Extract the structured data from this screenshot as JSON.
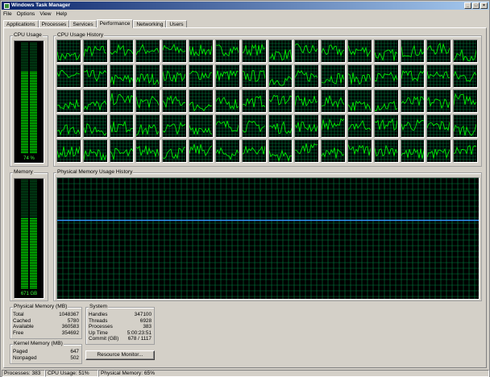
{
  "window": {
    "title": "Windows Task Manager"
  },
  "menu": [
    "File",
    "Options",
    "View",
    "Help"
  ],
  "tabs": [
    "Applications",
    "Processes",
    "Services",
    "Performance",
    "Networking",
    "Users"
  ],
  "active_tab": "Performance",
  "cpu_usage": {
    "label": "CPU Usage",
    "percent_text": "74 %",
    "level": 0.74
  },
  "cpu_history": {
    "label": "CPU Usage History",
    "cols": 16,
    "rows": 5,
    "core_count": 80
  },
  "memory": {
    "label": "Memory",
    "value_text": "671 GB",
    "level": 0.65
  },
  "memory_history": {
    "label": "Physical Memory Usage History",
    "level": 0.65
  },
  "physical_memory": {
    "title": "Physical Memory (MB)",
    "rows": [
      {
        "label": "Total",
        "value": "1048367"
      },
      {
        "label": "Cached",
        "value": "5780"
      },
      {
        "label": "Available",
        "value": "360583"
      },
      {
        "label": "Free",
        "value": "354692"
      }
    ]
  },
  "kernel_memory": {
    "title": "Kernel Memory (MB)",
    "rows": [
      {
        "label": "Paged",
        "value": "647"
      },
      {
        "label": "Nonpaged",
        "value": "502"
      }
    ]
  },
  "system": {
    "title": "System",
    "rows": [
      {
        "label": "Handles",
        "value": "347100"
      },
      {
        "label": "Threads",
        "value": "6928"
      },
      {
        "label": "Processes",
        "value": "383"
      },
      {
        "label": "Up Time",
        "value": "5:00:23:51"
      },
      {
        "label": "Commit (GB)",
        "value": "678 / 1117"
      }
    ]
  },
  "resource_monitor_button": "Resource Monitor...",
  "statusbar": {
    "processes": "Processes: 383",
    "cpu": "CPU Usage: 51%",
    "memory": "Physical Memory: 65%"
  },
  "colors": {
    "graph_line": "#00ff00",
    "grid": "#008040",
    "memory_line": "#3399ff",
    "meter_on": "#00ff00",
    "meter_off": "#00581c"
  }
}
